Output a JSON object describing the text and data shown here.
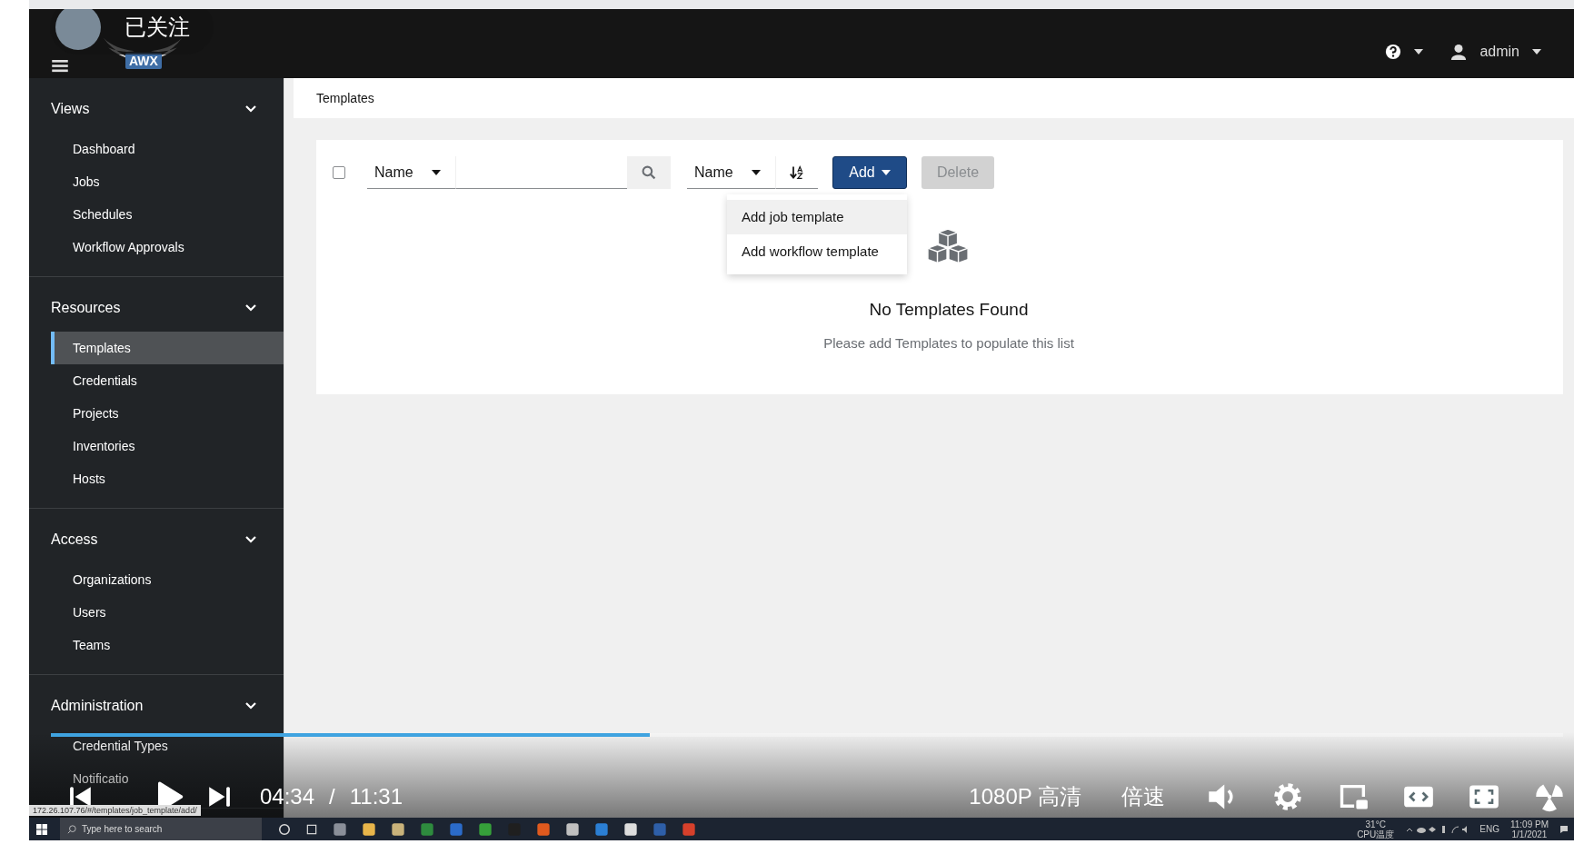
{
  "player": {
    "follow_label": "已关注",
    "progress": {
      "level": 0.396
    },
    "current_time": "04:34",
    "separator": "/",
    "duration": "11:31",
    "quality": "1080P 高清",
    "speed": "倍速"
  },
  "app": {
    "logo_text": "AWX",
    "user": "admin",
    "sidebar": [
      {
        "title": "Views",
        "expanded": true,
        "items": [
          {
            "label": "Dashboard",
            "selected": false
          },
          {
            "label": "Jobs",
            "selected": false
          },
          {
            "label": "Schedules",
            "selected": false
          },
          {
            "label": "Workflow Approvals",
            "selected": false
          }
        ]
      },
      {
        "title": "Resources",
        "expanded": true,
        "items": [
          {
            "label": "Templates",
            "selected": true
          },
          {
            "label": "Credentials",
            "selected": false
          },
          {
            "label": "Projects",
            "selected": false
          },
          {
            "label": "Inventories",
            "selected": false
          },
          {
            "label": "Hosts",
            "selected": false
          }
        ]
      },
      {
        "title": "Access",
        "expanded": true,
        "items": [
          {
            "label": "Organizations",
            "selected": false
          },
          {
            "label": "Users",
            "selected": false
          },
          {
            "label": "Teams",
            "selected": false
          }
        ]
      },
      {
        "title": "Administration",
        "expanded": true,
        "items": [
          {
            "label": "Credential Types",
            "selected": false
          },
          {
            "label": "Notificatio",
            "selected": false
          }
        ]
      }
    ],
    "breadcrumb": "Templates",
    "toolbar": {
      "select_all_checked": false,
      "filter_field": "Name",
      "sort_field": "Name",
      "add_label": "Add",
      "delete_label": "Delete",
      "delete_disabled": true
    },
    "add_menu": [
      {
        "label": "Add job template",
        "highlighted": true
      },
      {
        "label": "Add workflow template",
        "highlighted": false
      }
    ],
    "empty_state": {
      "title": "No Templates Found",
      "message": "Please add Templates to populate this list"
    }
  },
  "status_url": "172.26.107.76/#/templates/job_template/add/",
  "taskbar": {
    "search_placeholder": "Type here to search",
    "temperature": "31°C",
    "temperature_label": "CPU温度",
    "language": "ENG",
    "time": "11:09 PM",
    "date": "1/1/2021"
  }
}
